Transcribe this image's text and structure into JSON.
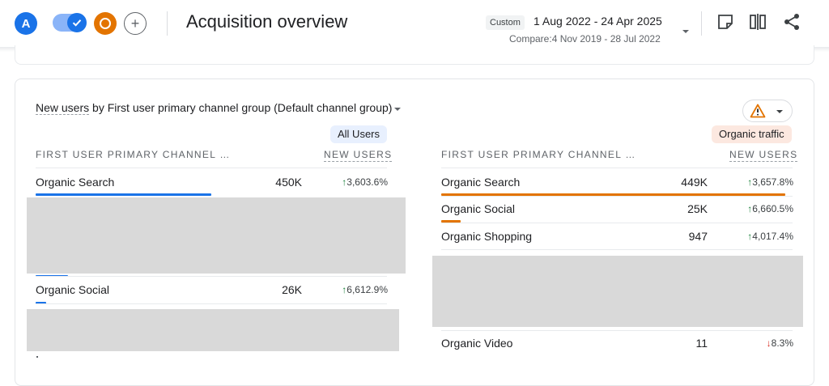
{
  "header": {
    "avatar_letter": "A",
    "title": "Acquisition overview",
    "custom_chip": "Custom",
    "date_range": "1 Aug 2022 - 24 Apr 2025",
    "compare_range": "Compare:4 Nov 2019 - 28 Jul 2022",
    "icons": [
      "edit-note-icon",
      "compare-columns-icon",
      "share-icon"
    ]
  },
  "card": {
    "title_metric": "New users",
    "title_by": " by ",
    "title_dimension": "First user primary channel group (Default channel group)",
    "left_segment": "All Users",
    "right_segment": "Organic traffic",
    "col_dimension": "FIRST USER PRIMARY CHANNEL …",
    "col_metric": "NEW USERS",
    "left_rows": [
      {
        "label": "Organic Search",
        "value": "450K",
        "change": "3,603.6%",
        "direction": "up",
        "share": 0.5
      },
      {
        "label": "Organic Social",
        "value": "26K",
        "change": "6,612.9%",
        "direction": "up",
        "share": 0.029
      }
    ],
    "right_rows": [
      {
        "label": "Organic Search",
        "value": "449K",
        "change": "3,657.8%",
        "direction": "up",
        "share": 0.98
      },
      {
        "label": "Organic Social",
        "value": "25K",
        "change": "6,660.5%",
        "direction": "up",
        "share": 0.055
      },
      {
        "label": "Organic Shopping",
        "value": "947",
        "change": "4,017.4%",
        "direction": "up",
        "share": 0.002
      },
      {
        "label": "Organic Video",
        "value": "11",
        "change": "8.3%",
        "direction": "down",
        "share": 0.0
      }
    ]
  },
  "colors": {
    "primary_blue": "#1a73e8",
    "orange": "#e37400",
    "up_green": "#188038",
    "down_red": "#d93025",
    "warning": "#e37400"
  }
}
